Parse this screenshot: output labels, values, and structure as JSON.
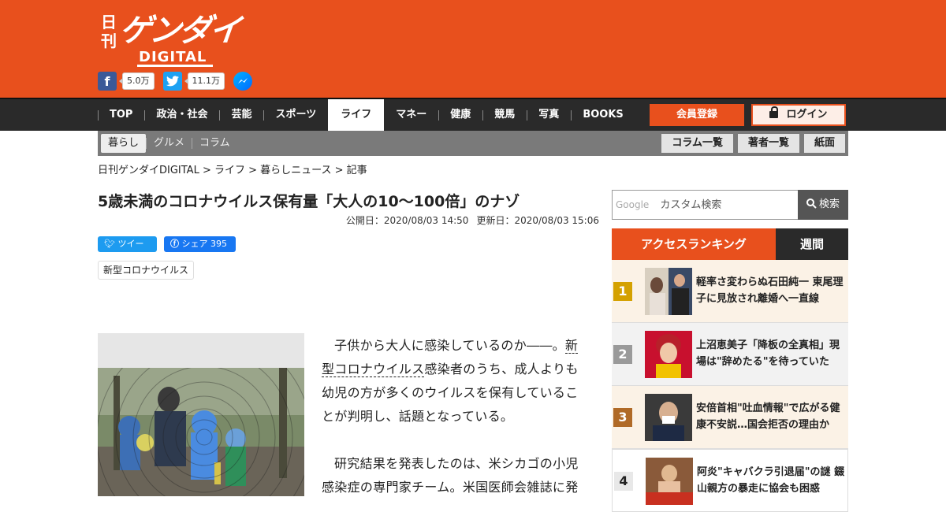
{
  "brand": {
    "nikkan": "日刊",
    "gendai": "ゲンダイ",
    "digital": "DIGITAL"
  },
  "social": {
    "facebook_count": "5.0万",
    "twitter_count": "11.1万"
  },
  "nav": {
    "items": [
      "TOP",
      "政治・社会",
      "芸能",
      "スポーツ",
      "ライフ",
      "マネー",
      "健康",
      "競馬",
      "写真",
      "BOOKS"
    ],
    "active": "ライフ",
    "register": "会員登録",
    "login": "ログイン"
  },
  "subnav": {
    "items": [
      "暮らし",
      "グルメ",
      "コラム"
    ],
    "buttons": [
      "コラム一覧",
      "著者一覧",
      "紙面"
    ]
  },
  "breadcrumb": "日刊ゲンダイDIGITAL > ライフ > 暮らしニュース > 記事",
  "article": {
    "title": "5歳未満のコロナウイルス保有量「大人の10～100倍」のナゾ",
    "published": "公開日：2020/08/03 14:50",
    "updated": "更新日：2020/08/03 15:06",
    "tweet": "ツイート",
    "share": "シェア",
    "share_count": "395",
    "tag": "新型コロナウイルス",
    "p1_a": "子供から大人に感染しているのか――。",
    "p1_link": "新型コロナウイルス",
    "p1_b": "感染者のうち、成人よりも幼児の方が多くのウイルスを保有していることが判明し、話題となっている。",
    "p2": "研究結果を発表したのは、米シカゴの小児感染症の専門家チーム。米国医師会雑誌に発"
  },
  "search": {
    "placeholder_brand": "Google",
    "placeholder": "カスタム検索",
    "button": "検索"
  },
  "ranking": {
    "title": "アクセスランキング",
    "period": "週間",
    "items": [
      {
        "rank": "1",
        "text": "軽率さ変わらぬ石田純一 東尾理子に見放され離婚へ一直線"
      },
      {
        "rank": "2",
        "text": "上沼恵美子「降板の全真相」現場は\"辞めたる\"を待っていた"
      },
      {
        "rank": "3",
        "text": "安倍首相\"吐血情報\"で広がる健康不安説…国会拒否の理由か"
      },
      {
        "rank": "4",
        "text": "阿炎\"キャバクラ引退届\"の謎 錣山親方の暴走に協会も困惑"
      }
    ]
  },
  "colors": {
    "brand": "#e8501d",
    "nav": "#2a2a2a"
  }
}
